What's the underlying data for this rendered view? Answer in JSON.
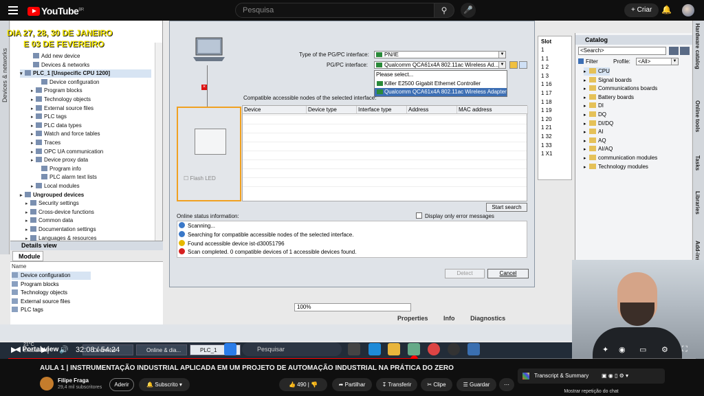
{
  "youtube": {
    "logo": "YouTube",
    "region": "BR",
    "search_placeholder": "Pesquisa",
    "create_label": "Criar"
  },
  "overlay": {
    "line1": "DIA 27, 28, 30 DE JANEIRO",
    "line2": "E 03 DE FEVEREIRO"
  },
  "tia": {
    "side_strip": "Devices & networks",
    "tree": [
      {
        "label": "Add new device"
      },
      {
        "label": "Devices & networks"
      },
      {
        "label": "PLC_1 [Unspecific CPU 1200]"
      },
      {
        "label": "Device configuration"
      },
      {
        "label": "Program blocks"
      },
      {
        "label": "Technology objects"
      },
      {
        "label": "External source files"
      },
      {
        "label": "PLC tags"
      },
      {
        "label": "PLC data types"
      },
      {
        "label": "Watch and force tables"
      },
      {
        "label": "Traces"
      },
      {
        "label": "OPC UA communication"
      },
      {
        "label": "Device proxy data"
      },
      {
        "label": "Program info"
      },
      {
        "label": "PLC alarm text lists"
      },
      {
        "label": "Local modules"
      },
      {
        "label": "Ungrouped devices"
      },
      {
        "label": "Security settings"
      },
      {
        "label": "Cross-device functions"
      },
      {
        "label": "Common data"
      },
      {
        "label": "Documentation settings"
      },
      {
        "label": "Languages & resources"
      }
    ],
    "details_view": "Details view",
    "module_tab": "Module",
    "details_col": "Name",
    "details_rows": [
      "Device configuration",
      "Program blocks",
      "Technology objects",
      "External source files",
      "PLC tags"
    ],
    "dialog": {
      "type_label": "Type of the PG/PC interface:",
      "type_value": "PN/IE",
      "iface_label": "PG/PC interface:",
      "iface_value": "Qualcomm QCA61x4A 802.11ac Wireless Ad...",
      "dropdown_items": [
        "Please select...",
        "Killer E2500 Gigabit Ethernet Controller",
        "Qualcomm QCA61x4A 802.11ac Wireless Adapter"
      ],
      "compat_label": "Compatible accessible nodes of the selected interface:",
      "columns": [
        "Device",
        "Device type",
        "Interface type",
        "Address",
        "MAC address"
      ],
      "flash_led": "Flash LED",
      "start_search": "Start search",
      "online_status": "Online status information:",
      "error_only": "Display only error messages",
      "status": [
        {
          "text": "Scanning...",
          "color": "#3a78c8"
        },
        {
          "text": "Searching for compatible accessible nodes of the selected interface.",
          "color": "#3a78c8"
        },
        {
          "text": "Found accessible device ist-d30051796",
          "color": "#e6b800"
        },
        {
          "text": "Scan completed. 0 compatible devices of 1 accessible devices found.",
          "color": "#d62020"
        }
      ],
      "detect": "Detect",
      "cancel": "Cancel"
    },
    "zoom": "100%",
    "slot_header": "Slot",
    "slots": [
      "1",
      "1 1",
      "1 2",
      "1 3",
      "1 16",
      "1 17",
      "1 18",
      "1 19",
      "1 20",
      "1 21",
      "1 32",
      "1 33",
      "1 X1"
    ],
    "catalog": {
      "title": "Catalog",
      "search": "<Search>",
      "filter": "Filter",
      "profile": "Profile:",
      "profile_value": "<All>",
      "items": [
        "CPU",
        "Signal boards",
        "Communications boards",
        "Battery boards",
        "DI",
        "DQ",
        "DI/DQ",
        "AI",
        "AQ",
        "AI/AQ",
        "communication modules",
        "Technology modules"
      ]
    },
    "right_tabs": [
      "Hardware catalog",
      "Online tools",
      "Tasks",
      "Libraries",
      "Add-ins"
    ],
    "bottom_tabs": {
      "properties": "Properties",
      "info": "Info",
      "diagnostics": "Diagnostics"
    },
    "portal": {
      "portal_view": "Portal view",
      "tabs": [
        "Overview",
        "Online & dia...",
        "PLC_1"
      ]
    }
  },
  "player": {
    "time": "32:08 / 54:24",
    "progress": 0.59,
    "weather_temp": "21°C",
    "weather_desc": "Ensolarado",
    "taskbar_search": "Pesquisar"
  },
  "video": {
    "title": "AULA 1 | INSTRUMENTAÇÃO INDUSTRIAL APLICADA EM UM PROJETO DE AUTOMAÇÃO INDUSTRIAL NA PRÁTICA DO ZERO",
    "channel": "Filipe Fraga",
    "subs": "29,4 mil subscritores",
    "join": "Aderir",
    "subscribe": "Subscrito",
    "likes": "490",
    "share": "Partilhar",
    "download": "Transferir",
    "clip": "Clipe",
    "save": "Guardar",
    "transcript": "Transcript & Summary",
    "chat_replay": "Mostrar repetição do chat"
  }
}
